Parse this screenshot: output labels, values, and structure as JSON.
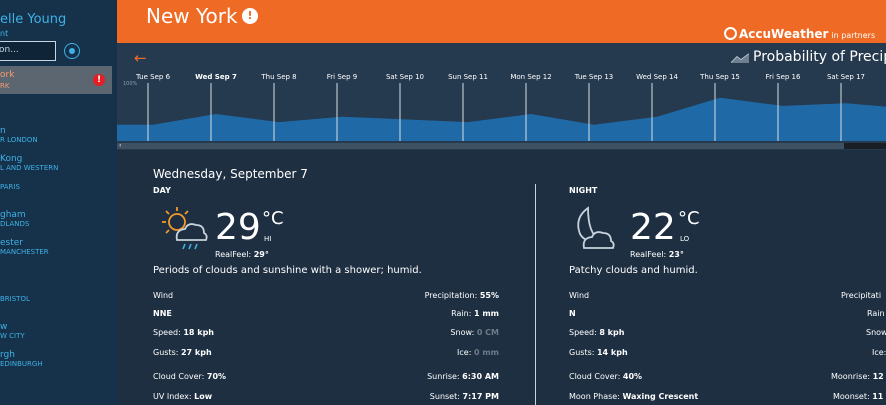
{
  "sidebar": {
    "user_name": "elle Young",
    "user_sub": "nt",
    "search_value": "on...",
    "selected_city": {
      "name": "ork",
      "sub": "RK",
      "alert": "!"
    },
    "cities": [
      {
        "name": "n",
        "sub": "R LONDON"
      },
      {
        "name": "Kong",
        "sub": "L AND WESTERN"
      },
      {
        "name": "",
        "sub": "PARIS"
      },
      {
        "name": "gham",
        "sub": "DLANDS"
      },
      {
        "name": "ester",
        "sub": "MANCHESTER"
      },
      {
        "name": "",
        "sub": "BRISTOL"
      },
      {
        "name": "w",
        "sub": "W CITY"
      },
      {
        "name": "rgh",
        "sub": "EDINBURGH"
      }
    ]
  },
  "header": {
    "title": "New York",
    "alert_glyph": "!",
    "brand": "AccuWeather",
    "partner": "in partners"
  },
  "timeline": {
    "back_glyph": "←",
    "title": "Probability of Precip",
    "pct_label": "100%",
    "days": [
      "Tue Sep 6",
      "Wed Sep 7",
      "Thu Sep 8",
      "Fri Sep 9",
      "Sat Sep 10",
      "Sun Sep 11",
      "Mon Sep 12",
      "Tue Sep 13",
      "Wed Sep 14",
      "Thu Sep 15",
      "Fri Sep 16",
      "Sat Sep 17",
      "S"
    ],
    "selected_day": "Wed Sep 7",
    "scroll_left_glyph": "‹",
    "accent": "#1f6aa6"
  },
  "chart_data": {
    "type": "area",
    "title": "Probability of Precip",
    "x": [
      "Tue Sep 6",
      "Wed Sep 7",
      "Thu Sep 8",
      "Fri Sep 9",
      "Sat Sep 10",
      "Sun Sep 11",
      "Mon Sep 12",
      "Tue Sep 13",
      "Wed Sep 14",
      "Thu Sep 15",
      "Fri Sep 16",
      "Sat Sep 17",
      "S"
    ],
    "series": [
      {
        "values": [
          30,
          50,
          35,
          45,
          40,
          35,
          50,
          30,
          45,
          80,
          65,
          70,
          60
        ]
      }
    ],
    "ylim": [
      0,
      100
    ]
  },
  "forecast": {
    "date": "Wednesday, September 7",
    "day": {
      "label": "DAY",
      "temp": "29",
      "unit": "°C",
      "hilo": "HI",
      "realfeel_label": "RealFeel:",
      "realfeel": "29°",
      "summary": "Periods of clouds and sunshine with a shower; humid.",
      "wind_label": "Wind",
      "wind_dir": "NNE",
      "speed_label": "Speed:",
      "speed": "18 kph",
      "gusts_label": "Gusts:",
      "gusts": "27 kph",
      "cloud_label": "Cloud Cover:",
      "cloud": "70%",
      "uv_label": "UV Index:",
      "uv": "Low",
      "precip_label": "Precipitation:",
      "precip": "55%",
      "rain_label": "Rain:",
      "rain": "1 mm",
      "snow_label": "Snow:",
      "snow": "0 CM",
      "ice_label": "Ice:",
      "ice": "0 mm",
      "sunrise_label": "Sunrise:",
      "sunrise": "6:30 AM",
      "sunset_label": "Sunset:",
      "sunset": "7:17 PM"
    },
    "night": {
      "label": "NIGHT",
      "temp": "22",
      "unit": "°C",
      "hilo": "LO",
      "realfeel_label": "RealFeel:",
      "realfeel": "23°",
      "summary": "Patchy clouds and humid.",
      "wind_label": "Wind",
      "wind_dir": "N",
      "speed_label": "Speed:",
      "speed": "8 kph",
      "gusts_label": "Gusts:",
      "gusts": "14 kph",
      "cloud_label": "Cloud Cover:",
      "cloud": "40%",
      "moonphase_label": "Moon Phase:",
      "moonphase": "Waxing Crescent",
      "precip_label": "Precipitati",
      "rain_label": "Rain",
      "snow_label": "Snow",
      "ice_label": "Ice:",
      "moonrise_label": "Moonrise:",
      "moonrise": "12",
      "moonset_label": "Moonset:",
      "moonset": "11"
    }
  },
  "colors": {
    "header": "#ef6b25",
    "sidebar": "#15324a",
    "link": "#3fb1e6",
    "sun": "#f39a2a"
  }
}
